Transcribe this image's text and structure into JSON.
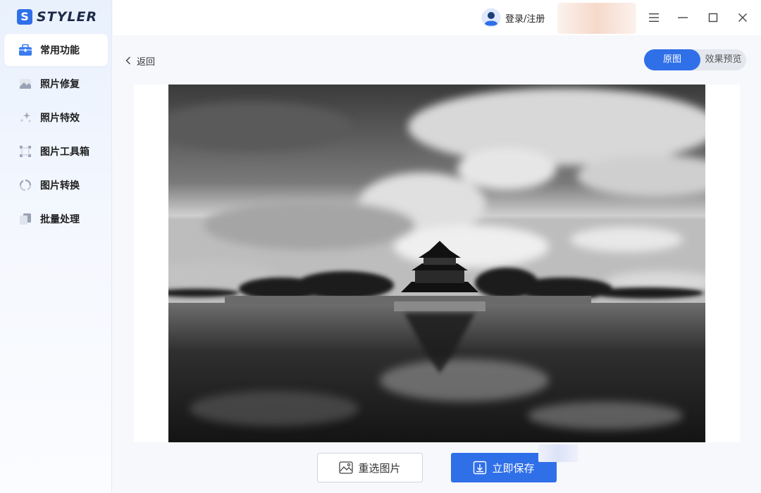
{
  "app": {
    "logo_letter": "S",
    "logo_text": "STYLER"
  },
  "sidebar": {
    "items": [
      {
        "label": "常用功能",
        "icon": "toolbox-icon",
        "active": true
      },
      {
        "label": "照片修复",
        "icon": "photo-repair-icon",
        "active": false
      },
      {
        "label": "照片特效",
        "icon": "sparkle-icon",
        "active": false
      },
      {
        "label": "图片工具箱",
        "icon": "crop-frame-icon",
        "active": false
      },
      {
        "label": "图片转换",
        "icon": "convert-icon",
        "active": false
      },
      {
        "label": "批量处理",
        "icon": "batch-icon",
        "active": false
      }
    ]
  },
  "topbar": {
    "login_label": "登录/注册",
    "window_controls": [
      "menu-icon",
      "minimize-icon",
      "maximize-icon",
      "close-icon"
    ]
  },
  "main": {
    "back_label": "返回",
    "toggle": {
      "original": "原图",
      "preview": "效果预览",
      "selected": "原图"
    },
    "image": {
      "description_icon": "photo-canvas",
      "mode": "grayscale"
    },
    "buttons": {
      "reselect": "重选图片",
      "save": "立即保存"
    }
  },
  "colors": {
    "accent": "#2f6fe8",
    "sidebar_bg": "#e9f1fd",
    "page_bg": "#f7f8fb"
  }
}
